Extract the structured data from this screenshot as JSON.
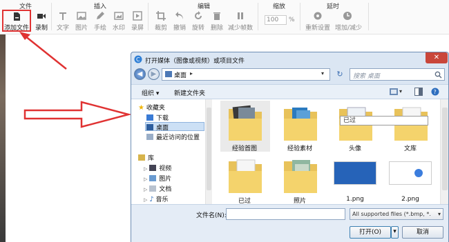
{
  "ribbon": {
    "groups": {
      "file": "文件",
      "insert": "插入",
      "edit": "编辑",
      "zoom": "缩放",
      "delay": "延时"
    },
    "buttons": {
      "add_file": "添加文件",
      "record": "录制",
      "text": "文字",
      "image": "图片",
      "handdraw": "手绘",
      "watermark": "水印",
      "screen": "录屏",
      "crop": "裁剪",
      "undo": "撤销",
      "rotate": "旋转",
      "delete": "删除",
      "reduce_frames": "减少帧数",
      "zoom_value": "100",
      "zoom_unit": "%",
      "reset": "重新设置",
      "add_reduce": "增加/减少"
    }
  },
  "dialog": {
    "title": "打开媒体（图像或视频）或项目文件",
    "close": "✕",
    "address": "桌面",
    "search_placeholder": "搜索 桌面",
    "toolbar": {
      "organize": "组织",
      "new_folder": "新建文件夹"
    },
    "nav": {
      "favorites": "收藏夹",
      "downloads": "下载",
      "desktop": "桌面",
      "recent": "最近访问的位置",
      "library": "库",
      "videos": "视频",
      "pictures": "图片",
      "documents": "文档",
      "music": "音乐"
    },
    "files": [
      {
        "name": "经验首图"
      },
      {
        "name": "经验素材"
      },
      {
        "name": "头像"
      },
      {
        "name": "文库"
      },
      {
        "name": "已过"
      },
      {
        "name": "照片"
      },
      {
        "name": "1.png"
      },
      {
        "name": "2.png"
      }
    ],
    "tooltip": "已过",
    "filename_label": "文件名(N):",
    "filename_value": "",
    "filetype": "All supported files (*.bmp, *.",
    "open": "打开(O)",
    "cancel": "取消"
  },
  "colors": {
    "highlight": "#e03232",
    "arrow": "#e03232"
  }
}
